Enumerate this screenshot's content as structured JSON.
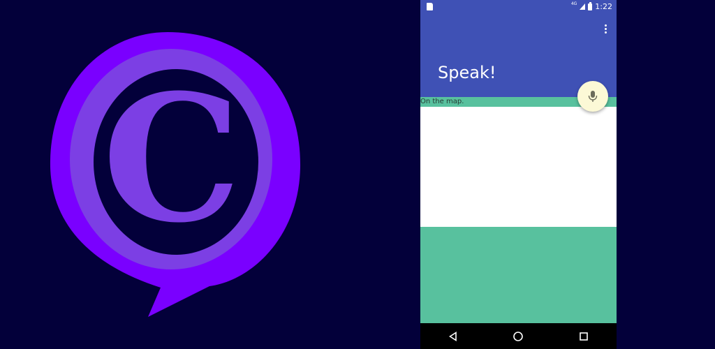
{
  "logo": {
    "letter": "C",
    "colors": {
      "outer": "#7a00ff",
      "inner": "#7c3fe4",
      "background": "#03003a"
    }
  },
  "status_bar": {
    "network": "4G",
    "time": "1:22",
    "icons": [
      "sd-card-icon",
      "signal-icon",
      "battery-icon"
    ]
  },
  "app_bar": {
    "title": "Speak!",
    "menu_icon": "more-vert-icon"
  },
  "content": {
    "map_label": "On the map."
  },
  "fab": {
    "icon": "microphone-icon"
  },
  "nav_bar": {
    "buttons": [
      "back-icon",
      "home-icon",
      "recents-icon"
    ]
  },
  "colors": {
    "primary": "#3f51b5",
    "accent": "#58c19e",
    "fab": "#fcf9d6",
    "panel": "#ffffff"
  }
}
